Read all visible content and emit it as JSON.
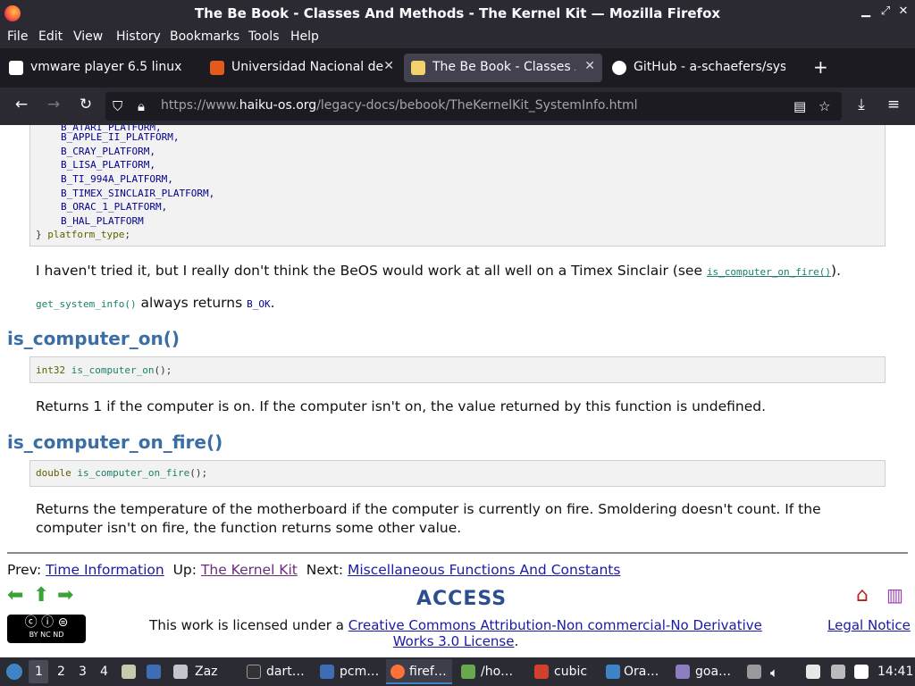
{
  "window": {
    "title": "The Be Book - Classes And Methods - The Kernel Kit — Mozilla Firefox"
  },
  "menu": [
    "File",
    "Edit",
    "View",
    "History",
    "Bookmarks",
    "Tools",
    "Help"
  ],
  "tabs": [
    {
      "label": "vmware player 6.5 linux",
      "icon": "google-icon",
      "color": "#ffffff"
    },
    {
      "label": "Universidad Nacional de",
      "icon": "university-icon",
      "color": "#e25a1c"
    },
    {
      "label": "The Be Book - Classes An",
      "icon": "haiku-icon",
      "color": "#f3d36b"
    },
    {
      "label": "GitHub - a-schaefers/syst",
      "icon": "github-icon",
      "color": "#ffffff"
    }
  ],
  "url": {
    "prefix": "https://www.",
    "domain": "haiku-os.org",
    "path": "/legacy-docs/bebook/TheKernelKit_SystemInfo.html"
  },
  "code_enum": {
    "partial": "B_ATARI_PLATFORM,",
    "lines": [
      "B_APPLE_II_PLATFORM,",
      "B_CRAY_PLATFORM,",
      "B_LISA_PLATFORM,",
      "B_TI_994A_PLATFORM,",
      "B_TIMEX_SINCLAIR_PLATFORM,",
      "B_ORAC_1_PLATFORM,",
      "B_HAL_PLATFORM"
    ],
    "close_brace": "}",
    "typename": "platform_type",
    "semi": ";"
  },
  "para1": {
    "text": "I haven't tried it, but I really don't think the BeOS would work at all well on a Timex Sinclair (see ",
    "link": "is_computer_on_fire()",
    "end": ")."
  },
  "para2": {
    "fn": "get_system_info()",
    "text": " always returns ",
    "const": "B_OK",
    "end": "."
  },
  "section1": {
    "heading": "is_computer_on()",
    "code_type": "int32",
    "code_fn": "is_computer_on",
    "code_end": "();",
    "desc": "Returns 1 if the computer is on. If the computer isn't on, the value returned by this function is undefined."
  },
  "section2": {
    "heading": "is_computer_on_fire()",
    "code_type": "double",
    "code_fn": "is_computer_on_fire",
    "code_end": "();",
    "desc_line1": "Returns the temperature of the motherboard if the computer is currently on fire. Smoldering doesn't count. If the",
    "desc_line2": "computer isn't on fire, the function returns some other value."
  },
  "footer_nav": {
    "prev_label": "Prev: ",
    "prev_link": "Time Information",
    "up_label": "Up: ",
    "up_link": "The Kernel Kit",
    "next_label": "Next: ",
    "next_link": "Miscellaneous Functions And Constants"
  },
  "access_logo": "ACCESS",
  "cc_badge": "BY NC ND",
  "license": {
    "text": "This work is licensed under a ",
    "link": "Creative Commons Attribution-Non commercial-No Derivative Works 3.0 License",
    "end": "."
  },
  "legal_notice": "Legal Notice",
  "taskbar": {
    "workspaces": [
      "1",
      "2",
      "3",
      "4"
    ],
    "items": [
      "Zaz",
      "dart…",
      "pcm…",
      "firef…",
      "/ho…",
      "cubic",
      "Ora…",
      "goa…"
    ],
    "clock": "14:41"
  }
}
